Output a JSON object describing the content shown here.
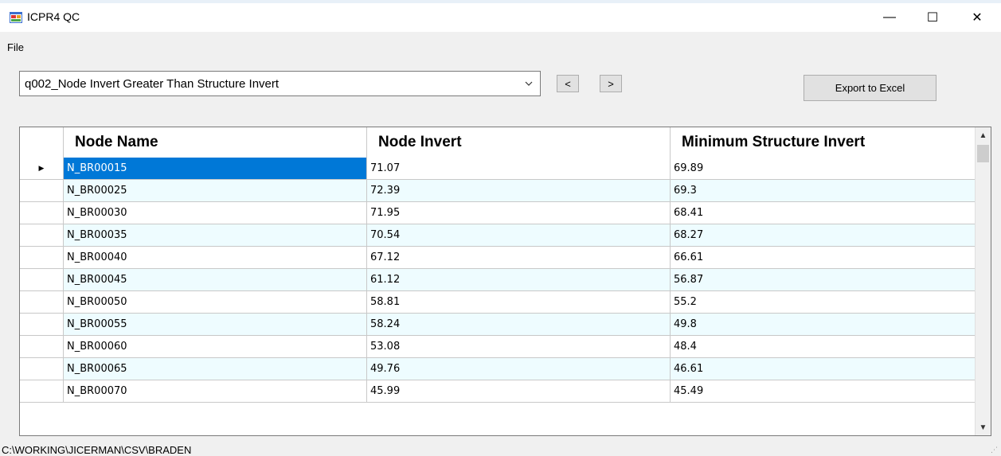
{
  "window": {
    "title": "ICPR4 QC",
    "minimize_glyph": "—",
    "maximize_glyph": "☐",
    "close_glyph": "✕",
    "icon": "app-window-icon"
  },
  "menu": {
    "file_label": "File"
  },
  "toolbar": {
    "query_select_value": "q002_Node Invert Greater Than Structure Invert",
    "prev_label": "<",
    "next_label": ">",
    "export_label": "Export to Excel"
  },
  "grid": {
    "columns": [
      "Node Name",
      "Node Invert",
      "Minimum Structure Invert"
    ],
    "current_row_marker": "▶",
    "rows": [
      {
        "name": "N_BR00015",
        "node_invert": "71.07",
        "min_structure_invert": "69.89"
      },
      {
        "name": "N_BR00025",
        "node_invert": "72.39",
        "min_structure_invert": "69.3"
      },
      {
        "name": "N_BR00030",
        "node_invert": "71.95",
        "min_structure_invert": "68.41"
      },
      {
        "name": "N_BR00035",
        "node_invert": "70.54",
        "min_structure_invert": "68.27"
      },
      {
        "name": "N_BR00040",
        "node_invert": "67.12",
        "min_structure_invert": "66.61"
      },
      {
        "name": "N_BR00045",
        "node_invert": "61.12",
        "min_structure_invert": "56.87"
      },
      {
        "name": "N_BR00050",
        "node_invert": "58.81",
        "min_structure_invert": "55.2"
      },
      {
        "name": "N_BR00055",
        "node_invert": "58.24",
        "min_structure_invert": "49.8"
      },
      {
        "name": "N_BR00060",
        "node_invert": "53.08",
        "min_structure_invert": "48.4"
      },
      {
        "name": "N_BR00065",
        "node_invert": "49.76",
        "min_structure_invert": "46.61"
      },
      {
        "name": "N_BR00070",
        "node_invert": "45.99",
        "min_structure_invert": "45.49"
      }
    ]
  },
  "statusbar": {
    "path": "C:\\WORKING\\JICERMAN\\CSV\\BRADEN"
  },
  "colors": {
    "selection": "#0078d7",
    "alt_row": "#eefcff"
  }
}
